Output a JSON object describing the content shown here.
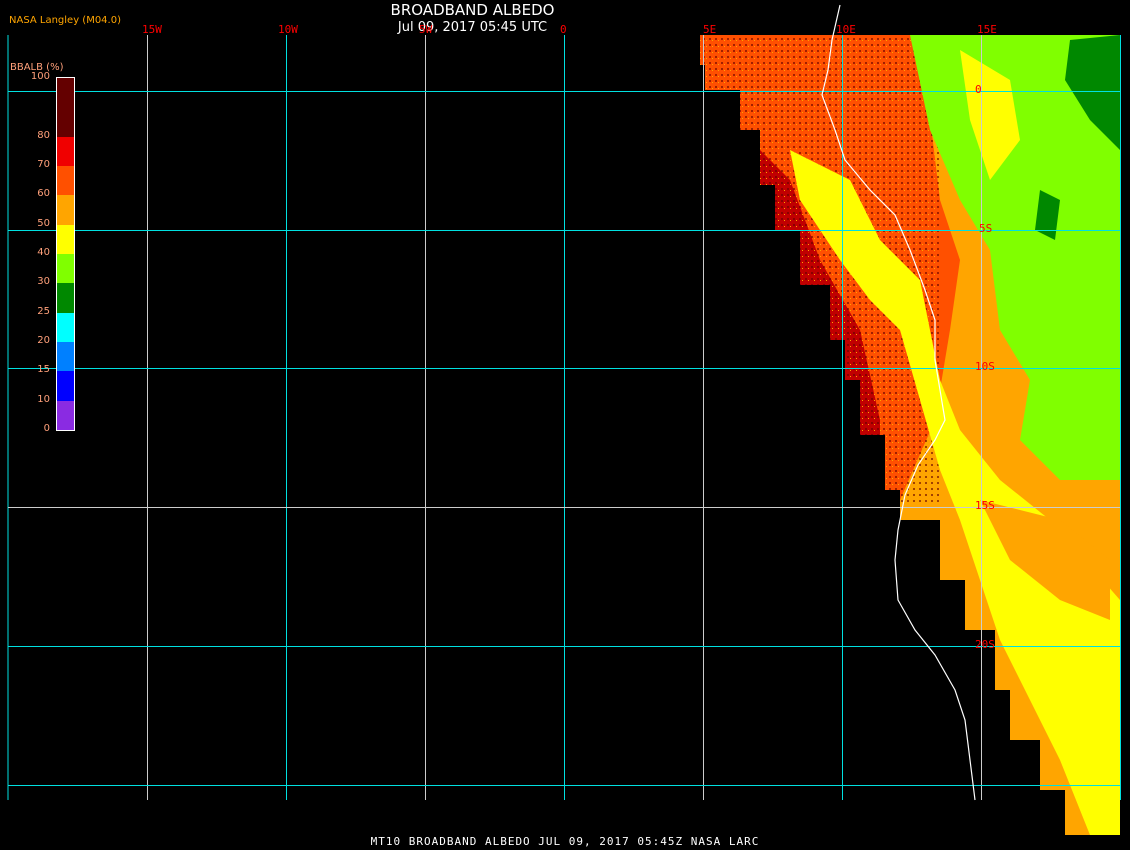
{
  "header": {
    "title": "BROADBAND ALBEDO",
    "subtitle": "Jul 09, 2017 05:45 UTC",
    "credit": "NASA Langley (M04.0)"
  },
  "footer": "MT10  BROADBAND ALBEDO   JUL 09, 2017 05:45Z   NASA LARC",
  "longitude_labels": [
    "15W",
    "10W",
    "5W",
    "0",
    "5E",
    "10E",
    "15E"
  ],
  "latitude_labels": [
    "0",
    "5S",
    "10S",
    "15S",
    "20S"
  ],
  "colorbar": {
    "title": "BBALB (%)",
    "tick_labels": [
      "100",
      "80",
      "70",
      "60",
      "50",
      "40",
      "30",
      "25",
      "20",
      "15",
      "10",
      "0"
    ],
    "bins": [
      {
        "range": "80-100",
        "color": "#640000"
      },
      {
        "range": "70-80",
        "color": "#f00000"
      },
      {
        "range": "60-70",
        "color": "#ff5000"
      },
      {
        "range": "50-60",
        "color": "#ffa500"
      },
      {
        "range": "40-50",
        "color": "#ffff00"
      },
      {
        "range": "30-40",
        "color": "#80ff00"
      },
      {
        "range": "25-30",
        "color": "#008800"
      },
      {
        "range": "20-25",
        "color": "#00ffff"
      },
      {
        "range": "15-20",
        "color": "#0080ff"
      },
      {
        "range": "10-15",
        "color": "#0000ff"
      },
      {
        "range": "0-10",
        "color": "#8a2be2"
      }
    ]
  }
}
